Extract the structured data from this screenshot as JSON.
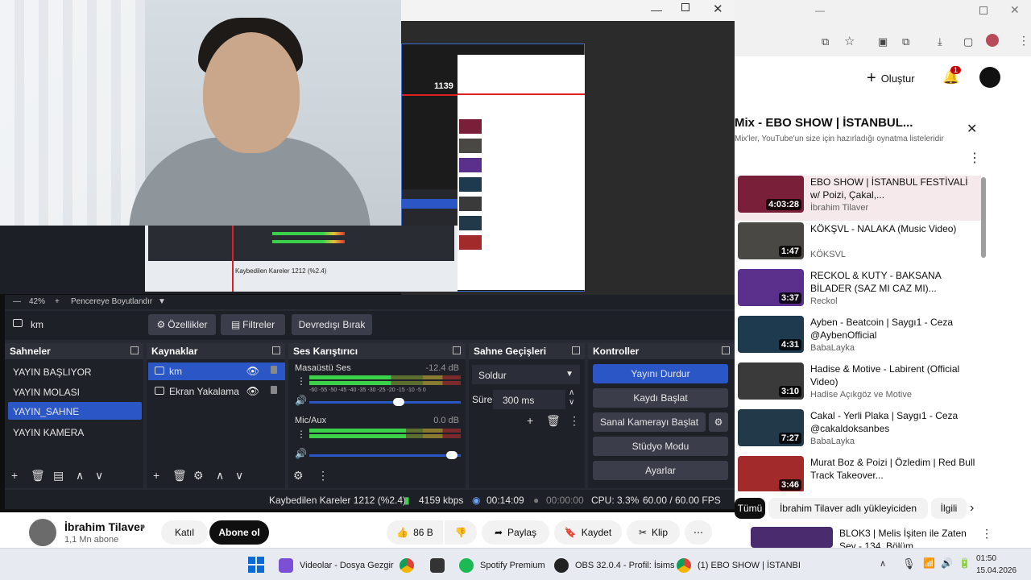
{
  "webcam": {},
  "nested_preview": {
    "fps_overlay": "1139",
    "labels": [
      "YAYIN KAMERA",
      "Kaybedilen Kareler 1212 (%2.4)",
      "4159 kbps",
      "00:14:09"
    ]
  },
  "obs": {
    "zoom": "42%",
    "zoom_fit": "Pencereye Boyutlandır",
    "current_source": "km",
    "properties_btn": "Özellikler",
    "filters_btn": "Filtreler",
    "deactivate_btn": "Devredışı Bırak",
    "scenes": {
      "title": "Sahneler",
      "items": [
        "YAYIN BAŞLIYOR",
        "YAYIN MOLASI",
        "YAYIN_SAHNE",
        "YAYIN KAMERA"
      ],
      "selected": "YAYIN_SAHNE"
    },
    "sources": {
      "title": "Kaynaklar",
      "items": [
        "km",
        "Ekran Yakalama"
      ]
    },
    "mixer": {
      "title": "Ses Karıştırıcı",
      "channels": [
        {
          "name": "Masaüstü Ses",
          "level": "-12.4 dB",
          "fill": 0.72
        },
        {
          "name": "Mic/Aux",
          "level": "0.0 dB",
          "fill": 0.85
        }
      ],
      "scale": "-60 -55 -50 -45 -40 -35 -30 -25 -20 -15 -10 -5 0"
    },
    "transitions": {
      "title": "Sahne Geçişleri",
      "type": "Soldur",
      "duration_label": "Süre",
      "duration": "300 ms"
    },
    "controls": {
      "title": "Kontroller",
      "buttons": [
        "Yayını Durdur",
        "Kaydı Başlat",
        "Sanal Kamerayı Başlat",
        "Stüdyo Modu",
        "Ayarlar"
      ]
    },
    "status": {
      "dropped": "Kaybedilen Kareler 1212 (%2.4)",
      "bitrate": "4159 kbps",
      "stream_time": "00:14:09",
      "rec_time": "00:00:00",
      "cpu": "CPU: 3.3%",
      "fps": "60.00 / 60.00 FPS"
    }
  },
  "youtube": {
    "create_btn": "Oluştur",
    "notif_count": "1",
    "mix_title": "Mix - EBO SHOW | İSTANBUL...",
    "mix_subtitle": "Mix'ler, YouTube'un size için hazırladığı oynatma listeleridir",
    "playlist": [
      {
        "title": "EBO SHOW | İSTANBUL FESTİVALİ w/ Poizi, Çakal,...",
        "channel": "İbrahim Tilaver",
        "duration": "4:03:28",
        "thumb_color": "#7a1f3a"
      },
      {
        "title": "KÖKŞVL - NALAKA (Music Video)",
        "channel": "KÖKSVL",
        "duration": "1:47",
        "thumb_color": "#4a4844"
      },
      {
        "title": "RECKOL & KUTY - BAKSANA BİLADER (SAZ MI CAZ MI)...",
        "channel": "Reckol",
        "duration": "3:37",
        "thumb_color": "#5b2f8c"
      },
      {
        "title": "Ayben - Beatcoin | Saygı1 - Ceza @AybenOfficial",
        "channel": "BabaLayka",
        "duration": "4:31",
        "thumb_color": "#1d3a4e"
      },
      {
        "title": "Hadise & Motive - Labirent (Official Video)",
        "channel": "Hadise Açıkgöz ve Motive",
        "duration": "3:10",
        "thumb_color": "#3a3a3a"
      },
      {
        "title": "Cakal - Yerli Plaka | Saygı1 - Ceza @cakaldoksanbes",
        "channel": "BabaLayka",
        "duration": "7:27",
        "thumb_color": "#22394a"
      },
      {
        "title": "Murat Boz & Poizi | Özledim | Red Bull Track Takeover...",
        "channel": "",
        "duration": "3:46",
        "thumb_color": "#a32a2a"
      }
    ],
    "channel_name": "İbrahim Tilaver",
    "subscribers": "1,1 Mn abone",
    "join_btn": "Katıl",
    "subscribe_btn": "Abone ol",
    "likes": "86 B",
    "share": "Paylaş",
    "save": "Kaydet",
    "clip": "Klip",
    "chips": [
      "Tümü",
      "İbrahim Tilaver adlı yükleyiciden",
      "İlgili"
    ],
    "next_video": "BLOK3 | Melis İşiten ile Zaten Sey - 134. Bölüm"
  },
  "taskbar": {
    "apps": [
      "Videolar - Dosya Gezgir",
      "Spotify Premium",
      "OBS 32.0.4 - Profil: İsims",
      "(1) EBO SHOW | İSTANBI"
    ],
    "time": "01:50",
    "date": "15.04.2026"
  }
}
